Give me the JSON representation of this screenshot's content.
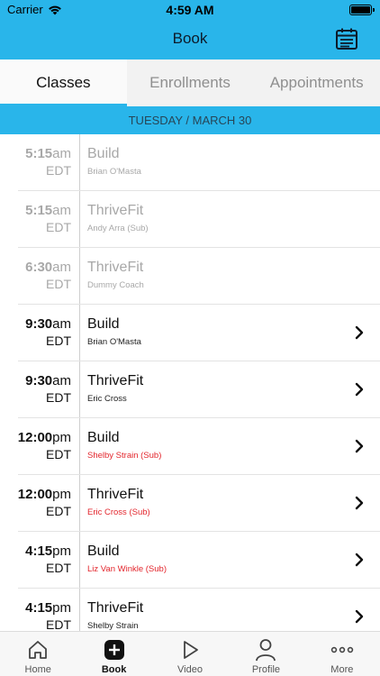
{
  "status": {
    "carrier": "Carrier",
    "time": "4:59 AM"
  },
  "nav": {
    "title": "Book",
    "calendar_icon": "calendar-icon"
  },
  "tabs": [
    {
      "label": "Classes",
      "active": true
    },
    {
      "label": "Enrollments",
      "active": false
    },
    {
      "label": "Appointments",
      "active": false
    }
  ],
  "date_header": "TUESDAY / MARCH 30",
  "classes": [
    {
      "time": "5:15",
      "ampm": "am",
      "tz": "EDT",
      "name": "Build",
      "instructor": "Brian O'Masta",
      "past": true
    },
    {
      "time": "5:15",
      "ampm": "am",
      "tz": "EDT",
      "name": "ThriveFit",
      "instructor": "Andy Arra (Sub)",
      "past": true
    },
    {
      "time": "6:30",
      "ampm": "am",
      "tz": "EDT",
      "name": "ThriveFit",
      "instructor": "Dummy Coach",
      "past": true
    },
    {
      "time": "9:30",
      "ampm": "am",
      "tz": "EDT",
      "name": "Build",
      "instructor": "Brian O'Masta",
      "past": false
    },
    {
      "time": "9:30",
      "ampm": "am",
      "tz": "EDT",
      "name": "ThriveFit",
      "instructor": "Eric Cross",
      "past": false
    },
    {
      "time": "12:00",
      "ampm": "pm",
      "tz": "EDT",
      "name": "Build",
      "instructor": "Shelby Strain (Sub)",
      "past": false
    },
    {
      "time": "12:00",
      "ampm": "pm",
      "tz": "EDT",
      "name": "ThriveFit",
      "instructor": "Eric Cross (Sub)",
      "past": false
    },
    {
      "time": "4:15",
      "ampm": "pm",
      "tz": "EDT",
      "name": "Build",
      "instructor": "Liz Van Winkle (Sub)",
      "past": false
    },
    {
      "time": "4:15",
      "ampm": "pm",
      "tz": "EDT",
      "name": "ThriveFit",
      "instructor": "Shelby Strain",
      "past": false
    }
  ],
  "tabbar": [
    {
      "label": "Home",
      "icon": "home-icon",
      "active": false
    },
    {
      "label": "Book",
      "icon": "plus-square-icon",
      "active": true
    },
    {
      "label": "Video",
      "icon": "play-icon",
      "active": false
    },
    {
      "label": "Profile",
      "icon": "person-icon",
      "active": false
    },
    {
      "label": "More",
      "icon": "more-icon",
      "active": false
    }
  ],
  "colors": {
    "brand": "#29b5ea",
    "sub_instructor": "#e3262d",
    "past_text": "#a8a8a8"
  }
}
